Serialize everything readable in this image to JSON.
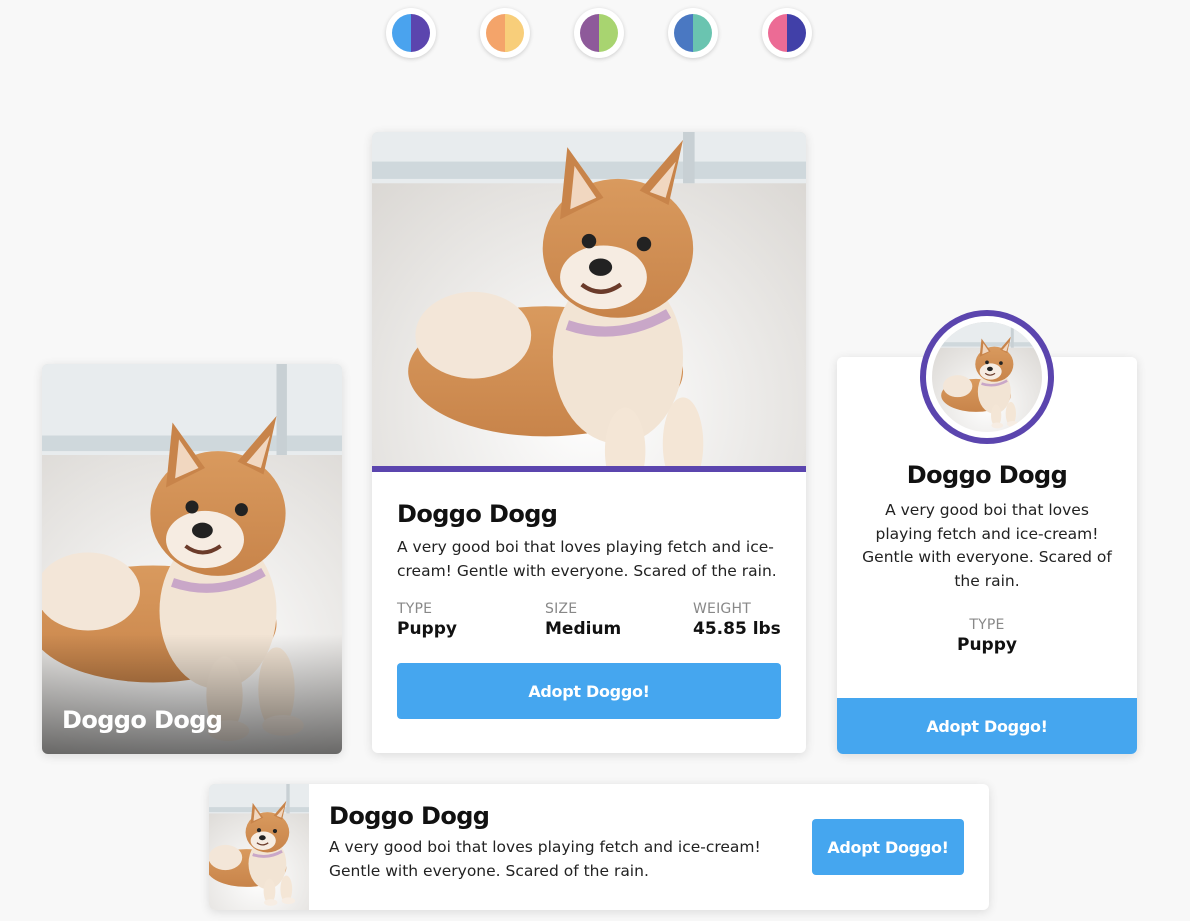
{
  "theme_swatches": [
    {
      "name": "blue-purple",
      "colors": [
        "#4aa3ee",
        "#5b45ae"
      ]
    },
    {
      "name": "orange-yellow",
      "colors": [
        "#f4a46a",
        "#f8ce7a"
      ]
    },
    {
      "name": "purple-green",
      "colors": [
        "#8e5a9a",
        "#a8d470"
      ]
    },
    {
      "name": "blue-teal",
      "colors": [
        "#4a78c2",
        "#6ac4b0"
      ]
    },
    {
      "name": "pink-indigo",
      "colors": [
        "#ec6b95",
        "#4140a8"
      ]
    }
  ],
  "accent_color": "#5b45ae",
  "button_color": "#45a6ef",
  "image_card": {
    "name": "Doggo Dogg"
  },
  "feature_card": {
    "name": "Doggo Dogg",
    "description": "A very good boi that loves playing fetch and ice-cream! Gentle with everyone. Scared of the rain.",
    "stats": [
      {
        "label": "Type",
        "value": "Puppy"
      },
      {
        "label": "Size",
        "value": "Medium"
      },
      {
        "label": "Weight",
        "value": "45.85 lbs"
      }
    ],
    "button_label": "Adopt Doggo!"
  },
  "profile_card": {
    "name": "Doggo Dogg",
    "description": "A very good boi that loves playing fetch and ice-cream! Gentle with everyone. Scared of the rain.",
    "stat": {
      "label": "Type",
      "value": "Puppy"
    },
    "button_label": "Adopt Doggo!"
  },
  "horizontal_card": {
    "name": "Doggo Dogg",
    "description": "A very good boi that loves playing fetch and ice-cream! Gentle with everyone. Scared of the rain.",
    "button_label": "Adopt Doggo!"
  }
}
